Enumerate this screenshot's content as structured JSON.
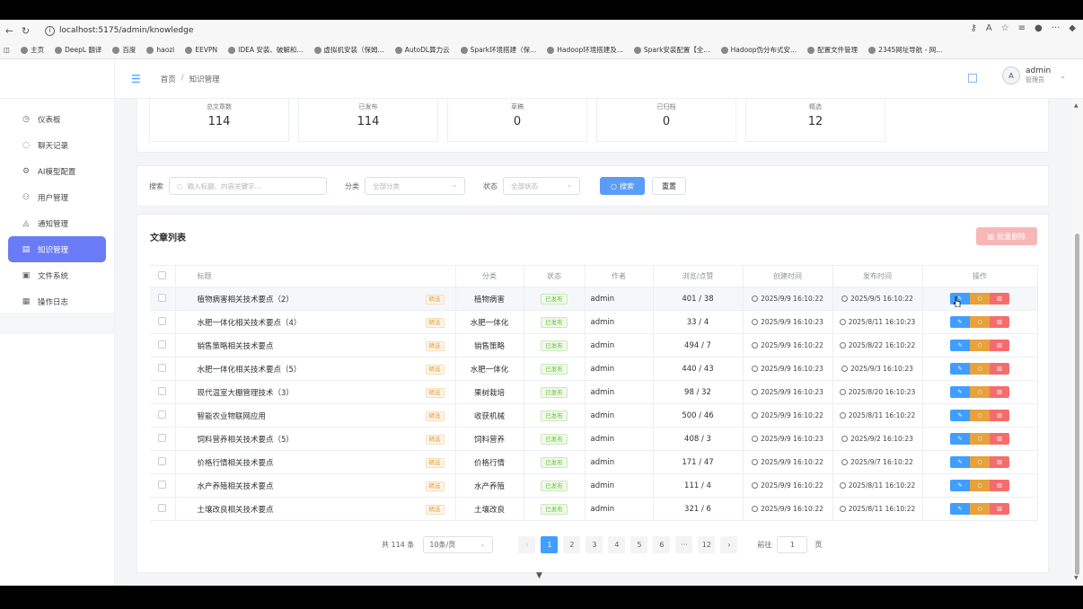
{
  "browser": {
    "url": "localhost:5175/admin/knowledge"
  },
  "bookmarks": [
    "主页",
    "DeepL 翻译",
    "百度",
    "haozi",
    "EEVPN",
    "IDEA 安装、破解和...",
    "虚拟机安装（保姆...",
    "AutoDL算力云",
    "Spark环境搭建（保...",
    "Hadoop环境搭建及...",
    "Spark安装配置【全...",
    "Hadoop伪分布式安...",
    "配置文件管理",
    "2345网址导航 - 网..."
  ],
  "sidebar": {
    "items": [
      {
        "label": "仪表板",
        "icon": "dashboard-icon",
        "glyph": "◷"
      },
      {
        "label": "聊天记录",
        "icon": "chat-icon",
        "glyph": "◌"
      },
      {
        "label": "AI模型配置",
        "icon": "gear-icon",
        "glyph": "⚙"
      },
      {
        "label": "用户管理",
        "icon": "user-icon",
        "glyph": "⚇"
      },
      {
        "label": "通知管理",
        "icon": "bell-icon",
        "glyph": "◬"
      },
      {
        "label": "知识管理",
        "icon": "document-icon",
        "glyph": "▤"
      },
      {
        "label": "文件系统",
        "icon": "folder-icon",
        "glyph": "▣"
      },
      {
        "label": "操作日志",
        "icon": "log-icon",
        "glyph": "▦"
      }
    ],
    "active_index": 5
  },
  "header": {
    "breadcrumb_home": "首页",
    "breadcrumb_sep": "/",
    "breadcrumb_current": "知识管理",
    "user_name": "admin",
    "user_role": "管理员",
    "avatar": "A"
  },
  "stats": [
    {
      "label": "总文章数",
      "value": "114"
    },
    {
      "label": "已发布",
      "value": "114"
    },
    {
      "label": "草稿",
      "value": "0"
    },
    {
      "label": "已归档",
      "value": "0"
    },
    {
      "label": "精选",
      "value": "12"
    }
  ],
  "search": {
    "label": "搜索",
    "placeholder": "输入标题、内容关键字...",
    "category_label": "分类",
    "category_value": "全部分类",
    "status_label": "状态",
    "status_value": "全部状态",
    "search_button": "搜索",
    "reset_button": "重置"
  },
  "list": {
    "title": "文章列表",
    "bulk_delete": "批量删除",
    "columns": [
      "标题",
      "分类",
      "状态",
      "作者",
      "浏览/点赞",
      "创建时间",
      "发布时间",
      "操作"
    ],
    "rows": [
      {
        "title": "植物病害相关技术要点（2）",
        "featured": "精选",
        "category": "植物病害",
        "status": "已发布",
        "author": "admin",
        "views": "401 / 38",
        "created": "2025/9/9 16:10:22",
        "published": "2025/9/5 16:10:22"
      },
      {
        "title": "水肥一体化相关技术要点（4）",
        "featured": "精选",
        "category": "水肥一体化",
        "status": "已发布",
        "author": "admin",
        "views": "33 / 4",
        "created": "2025/9/9 16:10:23",
        "published": "2025/8/11 16:10:23"
      },
      {
        "title": "销售策略相关技术要点",
        "featured": "精选",
        "category": "销售策略",
        "status": "已发布",
        "author": "admin",
        "views": "494 / 7",
        "created": "2025/9/9 16:10:22",
        "published": "2025/8/22 16:10:22"
      },
      {
        "title": "水肥一体化相关技术要点（5）",
        "featured": "精选",
        "category": "水肥一体化",
        "status": "已发布",
        "author": "admin",
        "views": "440 / 43",
        "created": "2025/9/9 16:10:23",
        "published": "2025/9/3 16:10:23"
      },
      {
        "title": "现代温室大棚管理技术（3）",
        "featured": "精选",
        "category": "果树栽培",
        "status": "已发布",
        "author": "admin",
        "views": "98 / 32",
        "created": "2025/9/9 16:10:23",
        "published": "2025/8/20 16:10:23"
      },
      {
        "title": "智能农业物联网应用",
        "featured": "精选",
        "category": "收获机械",
        "status": "已发布",
        "author": "admin",
        "views": "500 / 46",
        "created": "2025/9/9 16:10:22",
        "published": "2025/8/11 16:10:22"
      },
      {
        "title": "饲料营养相关技术要点（5）",
        "featured": "精选",
        "category": "饲料营养",
        "status": "已发布",
        "author": "admin",
        "views": "408 / 3",
        "created": "2025/9/9 16:10:23",
        "published": "2025/9/2 16:10:23"
      },
      {
        "title": "价格行情相关技术要点",
        "featured": "精选",
        "category": "价格行情",
        "status": "已发布",
        "author": "admin",
        "views": "171 / 47",
        "created": "2025/9/9 16:10:22",
        "published": "2025/9/7 16:10:22"
      },
      {
        "title": "水产养殖相关技术要点",
        "featured": "精选",
        "category": "水产养殖",
        "status": "已发布",
        "author": "admin",
        "views": "111 / 4",
        "created": "2025/9/9 16:10:22",
        "published": "2025/8/11 16:10:22"
      },
      {
        "title": "土壤改良相关技术要点",
        "featured": "精选",
        "category": "土壤改良",
        "status": "已发布",
        "author": "admin",
        "views": "321 / 6",
        "created": "2025/9/9 16:10:22",
        "published": "2025/8/11 16:10:22"
      }
    ]
  },
  "pagination": {
    "total": "共 114 条",
    "page_size": "10条/页",
    "pages": [
      "1",
      "2",
      "3",
      "4",
      "5",
      "6",
      "···",
      "12"
    ],
    "current": "1",
    "goto_label": "前往",
    "goto_value": "1",
    "page_unit": "页"
  },
  "colors": {
    "accent": "#409eff",
    "sidebar_active": "#6a7cf5",
    "warning": "#e6a23c",
    "danger": "#f56c6c",
    "success": "#67c23a"
  }
}
